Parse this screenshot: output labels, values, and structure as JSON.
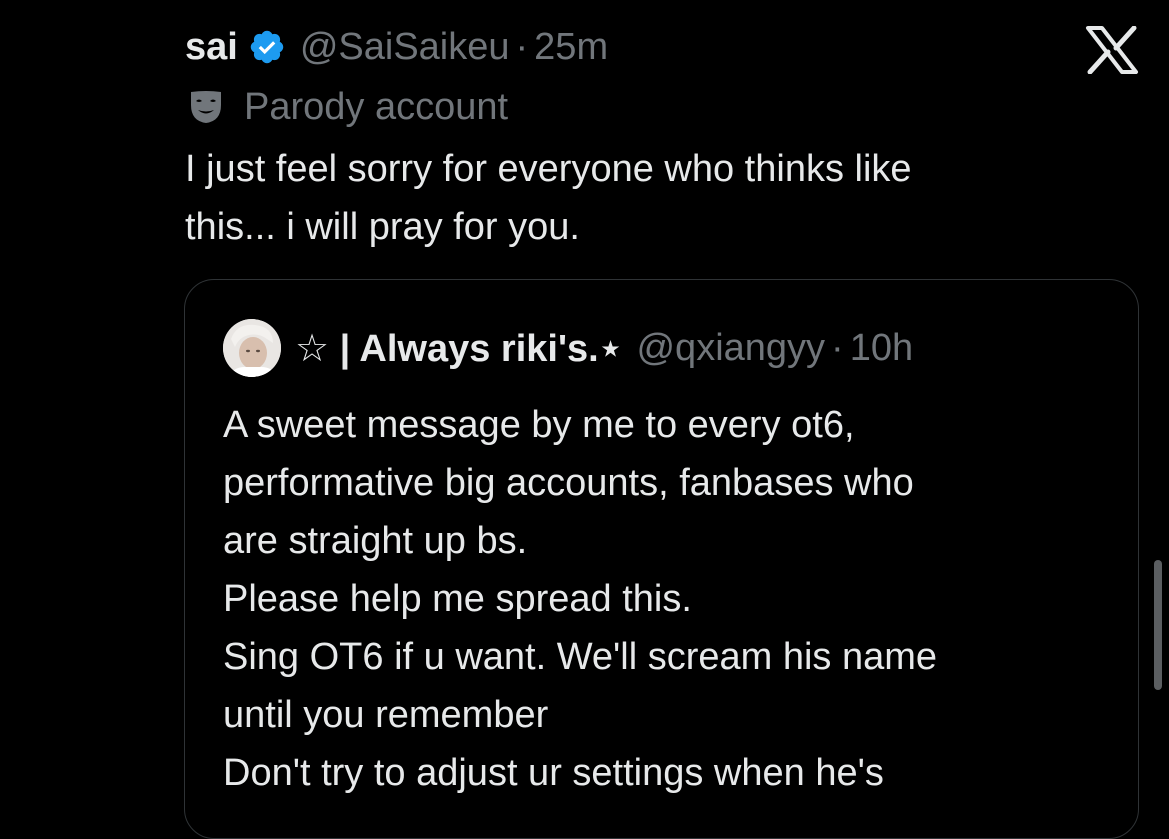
{
  "post": {
    "author_name": "sai",
    "handle": "@SaiSaikeu",
    "separator": "·",
    "time": "25m",
    "parody_label": "Parody account",
    "text": "I just feel sorry for everyone who thinks like\nthis... i will pray for you.",
    "icons": {
      "verified": "verified-badge-icon",
      "mask": "parody-mask-icon",
      "close": "x-logo-icon"
    }
  },
  "quote": {
    "author_name": "☆ | Always riki's.⋆",
    "handle": "@qxiangyy",
    "separator": "·",
    "time": "10h",
    "text": "A sweet message by me to every ot6,\nperformative big accounts, fanbases who\nare straight up bs.\nPlease help me spread this.\nSing OT6 if u want. We'll scream his name\nuntil you remember\nDon't try to adjust ur settings when he's"
  },
  "colors": {
    "background": "#000000",
    "primary_text": "#e7e9ea",
    "secondary_text": "#71767b",
    "verified_blue": "#1d9bf0",
    "border": "#2f3336"
  }
}
